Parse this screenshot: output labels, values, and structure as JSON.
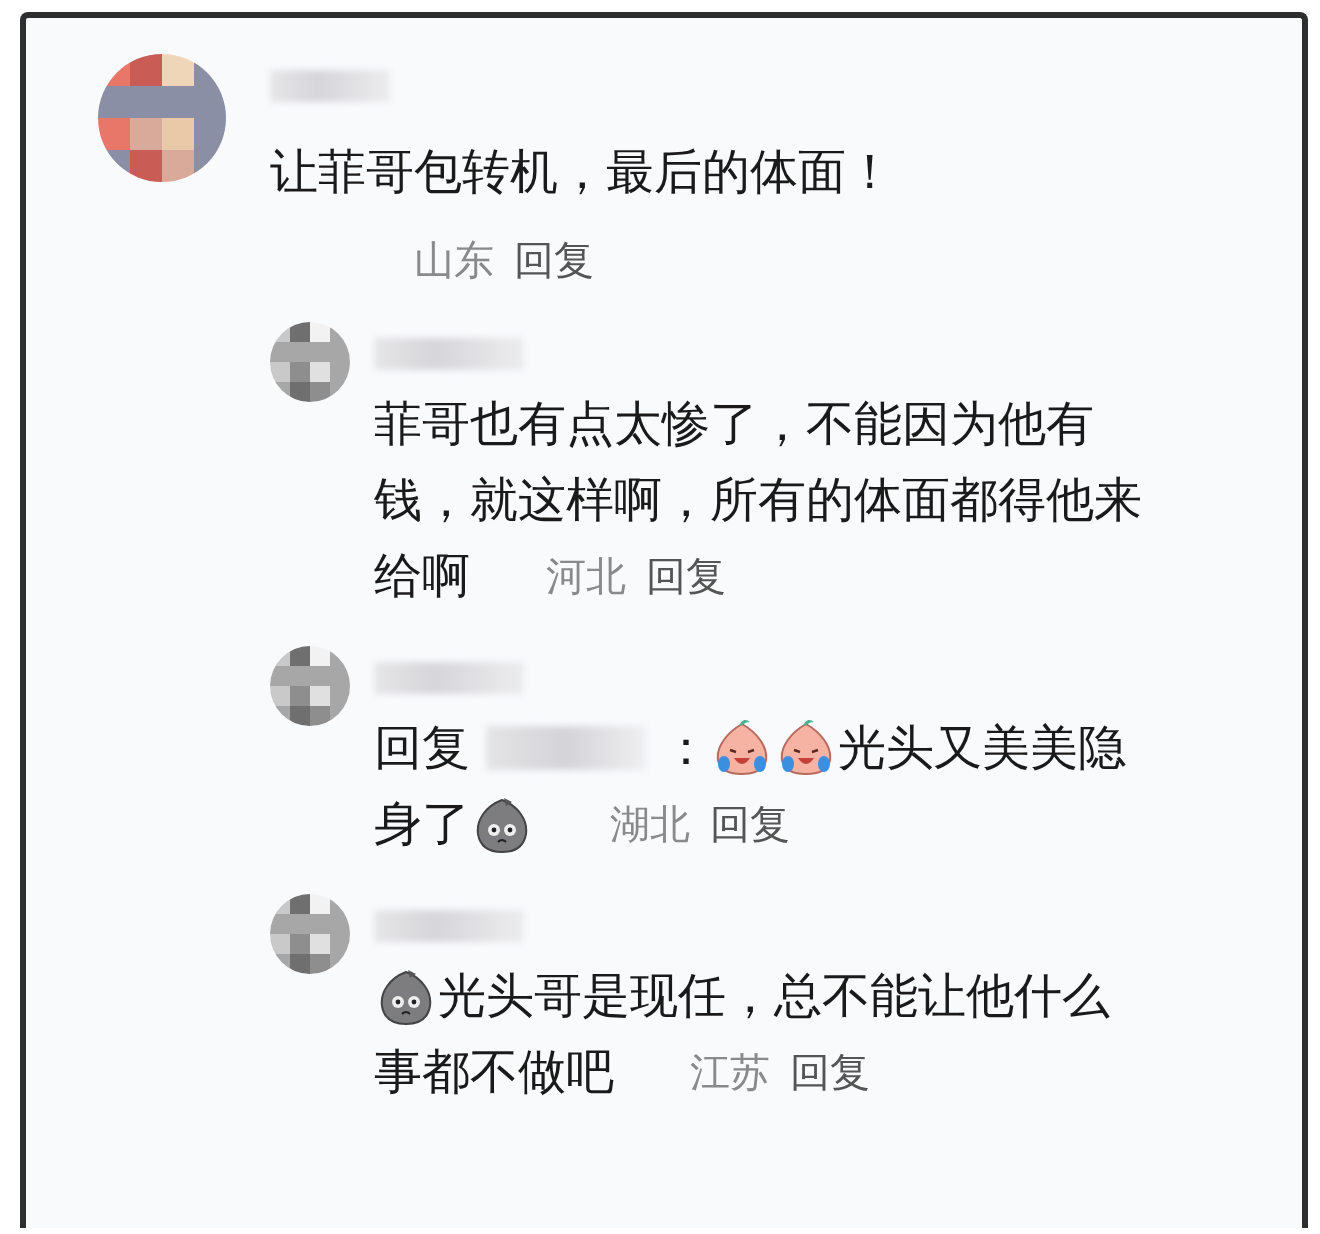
{
  "comments": [
    {
      "lines": [
        [
          {
            "kind": "text",
            "text": "让菲哥包转机，最后的体面！"
          }
        ]
      ],
      "location": "山东",
      "reply_label": "回复",
      "children": [
        {
          "lines": [
            [
              {
                "kind": "text",
                "text": "菲哥也有点太惨了，不能因为他有"
              }
            ],
            [
              {
                "kind": "text",
                "text": "钱，就这样啊，所有的体面都得他来"
              }
            ],
            [
              {
                "kind": "text",
                "text": "给啊"
              }
            ]
          ],
          "location": "河北",
          "reply_label": "回复"
        },
        {
          "lines": [
            [
              {
                "kind": "text",
                "text": "回复"
              },
              {
                "kind": "masked"
              },
              {
                "kind": "text",
                "text": "："
              },
              {
                "kind": "crying"
              },
              {
                "kind": "crying"
              },
              {
                "kind": "text",
                "text": "光头又美美隐"
              }
            ],
            [
              {
                "kind": "text",
                "text": "身了"
              },
              {
                "kind": "sack"
              }
            ]
          ],
          "location": "湖北",
          "reply_label": "回复"
        },
        {
          "lines": [
            [
              {
                "kind": "sack"
              },
              {
                "kind": "text",
                "text": "光头哥是现任，总不能让他什么"
              }
            ],
            [
              {
                "kind": "text",
                "text": "事都不做吧"
              }
            ]
          ],
          "location": "江苏",
          "reply_label": "回复"
        }
      ]
    }
  ]
}
